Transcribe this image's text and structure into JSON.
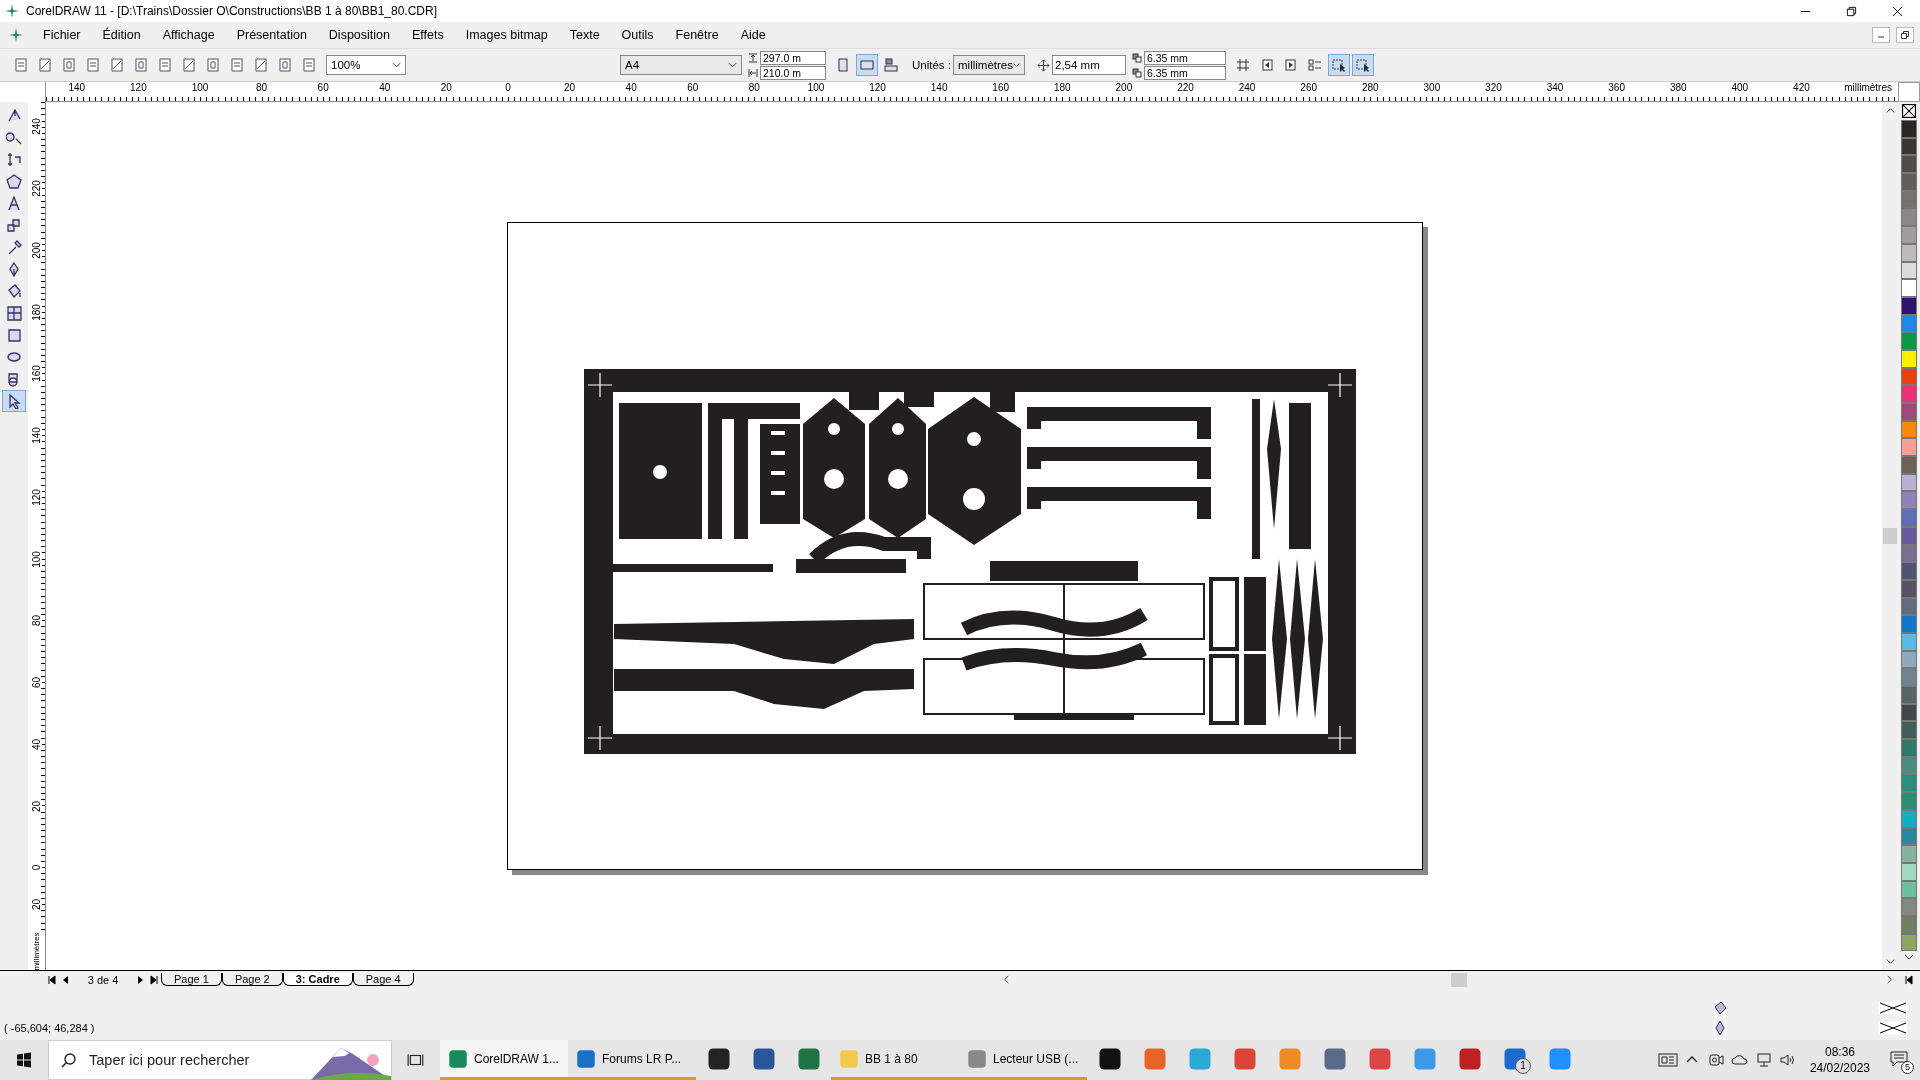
{
  "window": {
    "title": "CorelDRAW 11 - [D:\\Trains\\Dossier O\\Constructions\\BB 1 à 80\\BB1_80.CDR]"
  },
  "menu": [
    "Fichier",
    "Édition",
    "Affichage",
    "Présentation",
    "Disposition",
    "Effets",
    "Images bitmap",
    "Texte",
    "Outils",
    "Fenêtre",
    "Aide"
  ],
  "toolbar": {
    "zoom": "100%",
    "page_size": "A4",
    "width": "297.0 m",
    "height": "210.0 m",
    "orientation": [
      {
        "selected": false
      },
      {
        "selected": true
      }
    ],
    "units_label": "Unités :",
    "units": "millimètres",
    "nudge": "2,54 mm",
    "duplicate_x": "6.35 mm",
    "duplicate_y": "6.35 mm",
    "snap_toggles": [
      {
        "selected": true
      },
      {
        "selected": true
      }
    ]
  },
  "toolbox": [
    {
      "selected": false
    },
    {
      "selected": false
    },
    {
      "selected": false
    },
    {
      "selected": false
    },
    {
      "selected": false
    },
    {
      "selected": false
    },
    {
      "selected": false
    },
    {
      "selected": false
    },
    {
      "selected": false
    },
    {
      "selected": false
    },
    {
      "selected": false
    },
    {
      "selected": false
    },
    {
      "selected": false
    },
    {
      "selected": true
    }
  ],
  "ruler_h": {
    "labels": [
      "140",
      "120",
      "100",
      "80",
      "60",
      "40",
      "20",
      "0",
      "20",
      "40",
      "60",
      "80",
      "100",
      "120",
      "140",
      "160",
      "180",
      "200",
      "220",
      "240",
      "260",
      "280",
      "300",
      "320",
      "340",
      "360",
      "380",
      "400",
      "420"
    ],
    "unit": "millimètres"
  },
  "ruler_v": {
    "labels": [
      "240",
      "220",
      "200",
      "180",
      "160",
      "140",
      "120",
      "100",
      "80",
      "60",
      "40",
      "20",
      "0",
      "20"
    ],
    "unit": "millimètres"
  },
  "page_nav": {
    "counter": "3 de 4",
    "tabs": [
      {
        "label": "Page 1",
        "selected": false
      },
      {
        "label": "Page 2",
        "selected": false
      },
      {
        "label": "3: Cadre",
        "selected": true
      },
      {
        "label": "Page 4",
        "selected": false
      }
    ]
  },
  "status": {
    "coordinates": "( -65,604; 46,284 )"
  },
  "palette": {
    "colors": [
      {
        "color": "#2b2722"
      },
      {
        "color": "#3a3633"
      },
      {
        "color": "#514c48"
      },
      {
        "color": "#615d5a"
      },
      {
        "color": "#757270"
      },
      {
        "color": "#8a8886"
      },
      {
        "color": "#a09e9c"
      },
      {
        "color": "#bcbbb9"
      },
      {
        "color": "#dcdcdc"
      },
      {
        "color": "#ffffff"
      },
      {
        "color": "#2e1470"
      },
      {
        "color": "#1e88e5"
      },
      {
        "color": "#0a9a4a"
      },
      {
        "color": "#ffee00"
      },
      {
        "color": "#e8430f"
      },
      {
        "color": "#e8327a"
      },
      {
        "color": "#9c4a79"
      },
      {
        "color": "#f58a0a"
      },
      {
        "color": "#f7a09a"
      },
      {
        "color": "#6e6158"
      },
      {
        "color": "#b9b0d8"
      },
      {
        "color": "#9083ba"
      },
      {
        "color": "#5e70b0"
      },
      {
        "color": "#6a5898"
      },
      {
        "color": "#7a6f90"
      },
      {
        "color": "#4c5670"
      },
      {
        "color": "#575264"
      },
      {
        "color": "#616c80"
      },
      {
        "color": "#1076c8"
      },
      {
        "color": "#5ab8ea"
      },
      {
        "color": "#8fa8bc"
      },
      {
        "color": "#6f8290"
      },
      {
        "color": "#586468"
      },
      {
        "color": "#404848"
      },
      {
        "color": "#3e6058"
      },
      {
        "color": "#2e7a6a"
      },
      {
        "color": "#4d8a80"
      },
      {
        "color": "#289080"
      },
      {
        "color": "#2a9070"
      },
      {
        "color": "#10b0c0"
      },
      {
        "color": "#2888a0"
      },
      {
        "color": "#8ab0a0"
      },
      {
        "color": "#a0d8c0"
      },
      {
        "color": "#6cc09a"
      },
      {
        "color": "#808880"
      },
      {
        "color": "#708060"
      },
      {
        "color": "#8ca860"
      }
    ]
  },
  "taskbar": {
    "search_placeholder": "Taper ici pour rechercher",
    "apps": [
      {
        "kind": "window",
        "label": "CorelDRAW 1...",
        "selected": true
      },
      {
        "kind": "window",
        "label": "Forums LR P...",
        "selected": false
      },
      {
        "kind": "icon",
        "running": false
      },
      {
        "kind": "icon",
        "running": false
      },
      {
        "kind": "icon",
        "running": false
      },
      {
        "kind": "window",
        "label": "BB 1 à 80",
        "selected": false
      },
      {
        "kind": "window",
        "label": "Lecteur USB (...",
        "selected": false
      },
      {
        "kind": "icon",
        "running": false
      },
      {
        "kind": "icon",
        "running": false
      },
      {
        "kind": "icon",
        "running": false
      },
      {
        "kind": "icon",
        "running": false
      },
      {
        "kind": "icon",
        "running": false
      },
      {
        "kind": "icon",
        "running": false
      },
      {
        "kind": "icon",
        "running": false
      },
      {
        "kind": "icon",
        "running": false
      },
      {
        "kind": "icon",
        "running": false
      },
      {
        "kind": "icon",
        "running": false,
        "badge": "1"
      },
      {
        "kind": "icon",
        "running": false
      }
    ],
    "time": "08:36",
    "date": "24/02/2023",
    "notifications": "5"
  }
}
